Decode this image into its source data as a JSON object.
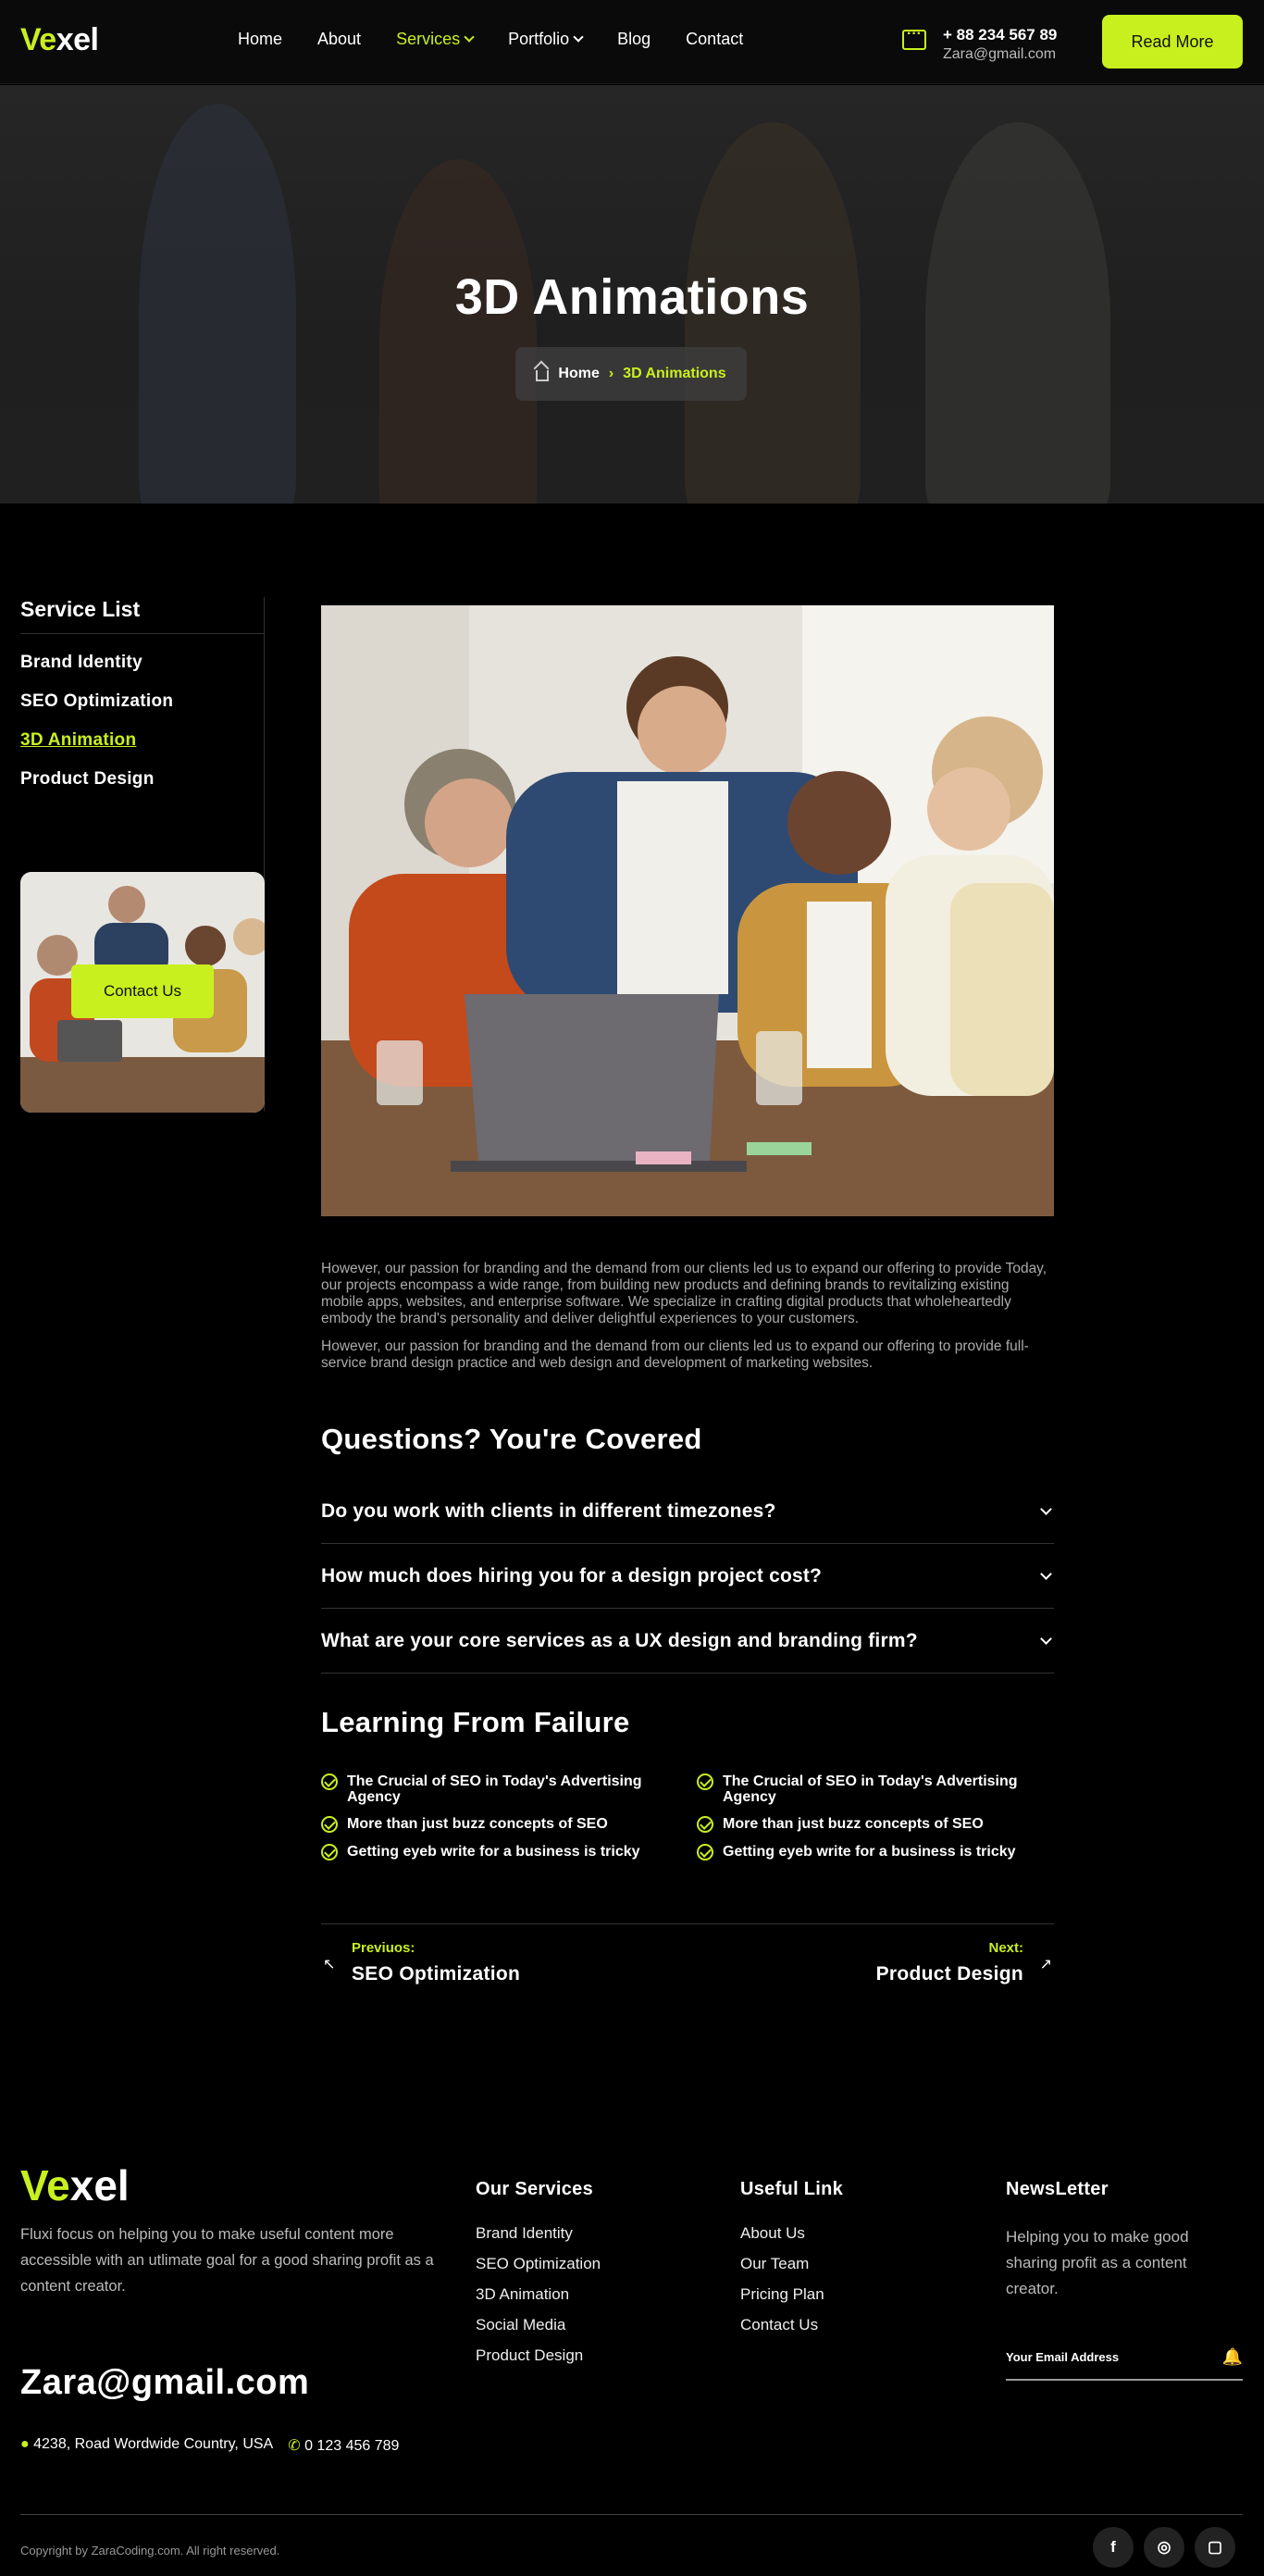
{
  "header": {
    "logo_part1": "Ve",
    "logo_part2": "xel",
    "nav": [
      {
        "label": "Home"
      },
      {
        "label": "About"
      },
      {
        "label": "Services"
      },
      {
        "label": "Portfolio"
      },
      {
        "label": "Blog"
      },
      {
        "label": "Contact"
      }
    ],
    "phone": "+ 88 234 567 89",
    "email": "Zara@gmail.com",
    "cta_label": "Read More"
  },
  "hero": {
    "title": "3D Animations",
    "breadcrumb_home": "Home",
    "breadcrumb_current": "3D Animations"
  },
  "sidebar": {
    "title": "Service List",
    "items": [
      {
        "label": "Brand Identity"
      },
      {
        "label": "SEO Optimization"
      },
      {
        "label": "3D Animation"
      },
      {
        "label": "Product Design"
      }
    ],
    "contact_label": "Contact Us"
  },
  "content": {
    "para1": "However, our passion for branding and the demand from our clients led us to expand our offering to provide Today, our projects encompass a wide range, from building new products and defining brands to revitalizing existing mobile apps, websites, and enterprise software. We specialize in crafting digital products that wholeheartedly embody the brand's personality and deliver delightful experiences to your customers.",
    "para2": "However, our passion for branding and the demand from our clients led us to expand our offering to provide full-service brand design practice and web design and development of marketing websites.",
    "faq_title": "Questions? You're Covered",
    "faqs": [
      {
        "q": "Do you work with clients in different timezones?"
      },
      {
        "q": "How much does hiring you for a design project cost?"
      },
      {
        "q": "What are your core services as a UX design and branding firm?"
      }
    ],
    "learning_title": "Learning From Failure",
    "checks_left": [
      {
        "text": "The Crucial of SEO in Today's Advertising Agency"
      },
      {
        "text": "More than just buzz concepts of SEO"
      },
      {
        "text": "Getting eyeb write for a business is tricky"
      }
    ],
    "checks_right": [
      {
        "text": "The Crucial of SEO in Today's Advertising Agency"
      },
      {
        "text": "More than just buzz concepts of SEO"
      },
      {
        "text": "Getting eyeb write for a business is tricky"
      }
    ],
    "prev_label": "Previuos:",
    "prev_title": "SEO Optimization",
    "next_label": "Next:",
    "next_title": "Product Design"
  },
  "footer": {
    "logo_part1": "Ve",
    "logo_part2": "xel",
    "description": "Fluxi focus on helping you to make useful content more accessible with an utlimate goal for a good sharing profit as a content creator.",
    "email": "Zara@gmail.com",
    "address": "4238, Road Wordwide Country, USA",
    "phone": "0 123 456 789",
    "services_title": "Our Services",
    "services": [
      {
        "label": "Brand Identity"
      },
      {
        "label": "SEO Optimization"
      },
      {
        "label": "3D Animation"
      },
      {
        "label": "Social Media"
      },
      {
        "label": "Product Design"
      }
    ],
    "links_title": "Useful Link",
    "links": [
      {
        "label": "About Us"
      },
      {
        "label": "Our Team"
      },
      {
        "label": "Pricing Plan"
      },
      {
        "label": "Contact Us"
      }
    ],
    "news_title": "NewsLetter",
    "news_text": "Helping you to make  good sharing profit as a content creator.",
    "news_placeholder": "Your Email Address",
    "copyright": "Copyright by ZaraCoding.com. All right reserved.",
    "socials": [
      {
        "icon": "facebook-icon"
      },
      {
        "icon": "dribbble-icon"
      },
      {
        "icon": "instagram-icon"
      }
    ]
  },
  "colors": {
    "accent": "#c8f01e",
    "background": "#000000"
  }
}
